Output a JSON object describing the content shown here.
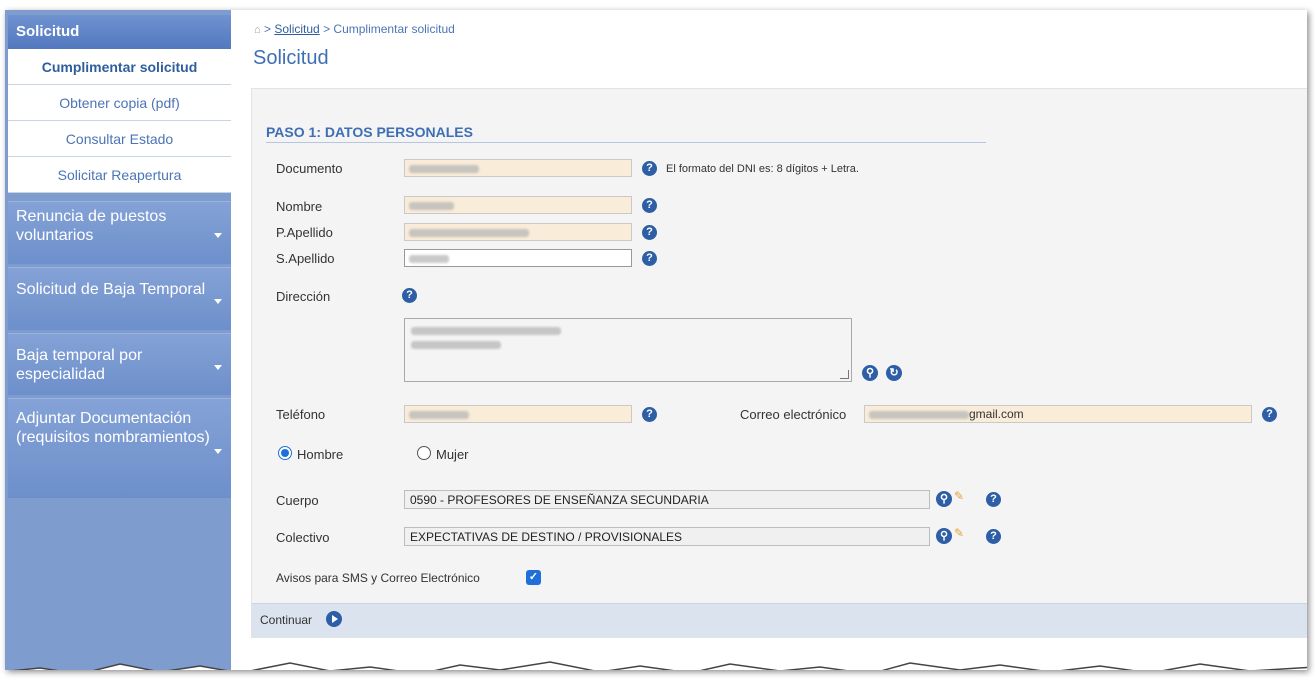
{
  "sidebar": {
    "header": "Solicitud",
    "subitems": [
      {
        "label": "Cumplimentar solicitud",
        "active": true
      },
      {
        "label": "Obtener copia (pdf)"
      },
      {
        "label": "Consultar Estado"
      },
      {
        "label": "Solicitar Reapertura"
      }
    ],
    "groups": [
      {
        "label": "Renuncia de puestos voluntarios"
      },
      {
        "label": "Solicitud de Baja Temporal"
      },
      {
        "label": "Baja temporal por especialidad"
      },
      {
        "label": "Adjuntar Documentación (requisitos nombramientos)"
      }
    ]
  },
  "breadcrumb": {
    "sep": ">",
    "link": "Solicitud",
    "current": "Cumplimentar solicitud"
  },
  "page_title": "Solicitud",
  "form": {
    "section_title": "PASO 1: DATOS PERSONALES",
    "documento_label": "Documento",
    "documento_note": "El formato del DNI es: 8 dígitos + Letra.",
    "nombre_label": "Nombre",
    "papellido_label": "P.Apellido",
    "sapellido_label": "S.Apellido",
    "direccion_label": "Dirección",
    "telefono_label": "Teléfono",
    "correo_label": "Correo electrónico",
    "correo_value": "gmail.com",
    "sexo_options": [
      "Hombre",
      "Mujer"
    ],
    "sexo_selected": "Hombre",
    "cuerpo_label": "Cuerpo",
    "cuerpo_value": "0590 - PROFESORES DE ENSEÑANZA SECUNDARIA",
    "colectivo_label": "Colectivo",
    "colectivo_value": "EXPECTATIVAS DE DESTINO / PROVISIONALES",
    "avisos_label": "Avisos para SMS y Correo Electrónico",
    "avisos_checked": true
  },
  "footer": {
    "continue_label": "Continuar"
  },
  "colors": {
    "accent": "#2e5fa6",
    "sidebar": "#7f9ccf",
    "field_bg": "#f9ecd9"
  }
}
